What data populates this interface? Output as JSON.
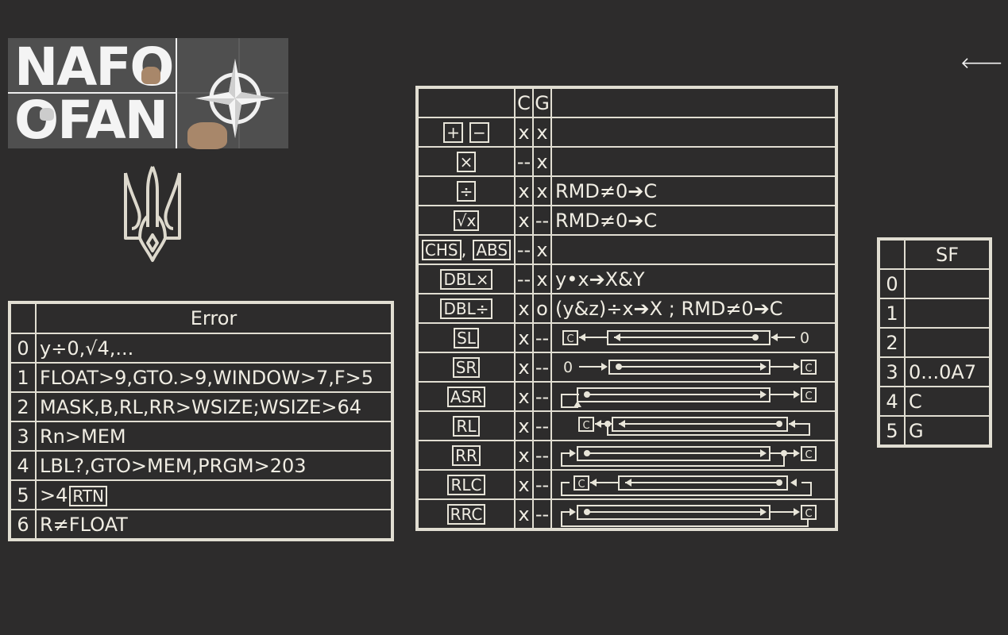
{
  "logo": {
    "line1": "NAFO",
    "line2": "OFAN"
  },
  "nav": {
    "back_icon": "arrow-left-icon",
    "back_glyph": "🡐"
  },
  "emblem": {
    "name": "tryzub-icon"
  },
  "error_table": {
    "header": "Error",
    "rows": [
      {
        "idx": "0",
        "text": "y÷0,√4,..."
      },
      {
        "idx": "1",
        "text": "FLOAT>9,GTO.>9,WINDOW>7,F>5"
      },
      {
        "idx": "2",
        "text": "MASK,B,RL,RR>WSIZE;WSIZE>64"
      },
      {
        "idx": "3",
        "text": "Rn>MEM"
      },
      {
        "idx": "4",
        "text": "LBL?,GTO>MEM,PRGM>203"
      },
      {
        "idx": "5",
        "text": ">4",
        "key": "RTN"
      },
      {
        "idx": "6",
        "text": "R≠FLOAT"
      }
    ]
  },
  "ops_table": {
    "header": {
      "op": "",
      "c": "C",
      "g": "G",
      "note": ""
    },
    "rows": [
      {
        "keys": [
          "+",
          "−"
        ],
        "c": "x",
        "g": "x",
        "note": ""
      },
      {
        "keys": [
          "×"
        ],
        "c": "--",
        "g": "x",
        "note": ""
      },
      {
        "keys": [
          "÷"
        ],
        "c": "x",
        "g": "x",
        "note": "RMD≠0➔C"
      },
      {
        "keys": [
          "√x"
        ],
        "c": "x",
        "g": "--",
        "note": "RMD≠0➔C"
      },
      {
        "keys": [
          "CHS",
          "ABS"
        ],
        "c": "--",
        "g": "x",
        "note": ""
      },
      {
        "keys": [
          "DBL×"
        ],
        "c": "--",
        "g": "x",
        "note": "y•x➔X&Y"
      },
      {
        "keys": [
          "DBL÷"
        ],
        "c": "x",
        "g": "o",
        "note": "(y&z)÷x➔X ; RMD≠0➔C"
      },
      {
        "keys": [
          "SL"
        ],
        "c": "x",
        "g": "--",
        "diagram": "sl",
        "zero": "0",
        "flag": "C"
      },
      {
        "keys": [
          "SR"
        ],
        "c": "x",
        "g": "--",
        "diagram": "sr",
        "zero": "0",
        "flag": "C"
      },
      {
        "keys": [
          "ASR"
        ],
        "c": "x",
        "g": "--",
        "diagram": "asr",
        "flag": "C"
      },
      {
        "keys": [
          "RL"
        ],
        "c": "x",
        "g": "--",
        "diagram": "rl",
        "flag": "C"
      },
      {
        "keys": [
          "RR"
        ],
        "c": "x",
        "g": "--",
        "diagram": "rr",
        "flag": "C"
      },
      {
        "keys": [
          "RLC"
        ],
        "c": "x",
        "g": "--",
        "diagram": "rlc",
        "flag": "C"
      },
      {
        "keys": [
          "RRC"
        ],
        "c": "x",
        "g": "--",
        "diagram": "rrc",
        "flag": "C"
      }
    ]
  },
  "sf_table": {
    "header": "SF",
    "rows": [
      {
        "idx": "0",
        "text": ""
      },
      {
        "idx": "1",
        "text": ""
      },
      {
        "idx": "2",
        "text": ""
      },
      {
        "idx": "3",
        "text": "0...0A7"
      },
      {
        "idx": "4",
        "text": "C"
      },
      {
        "idx": "5",
        "text": "G"
      }
    ]
  },
  "colors": {
    "background": "#2d2c2c",
    "line": "#e1ded2",
    "logo_bg": "#4f4f4f"
  }
}
